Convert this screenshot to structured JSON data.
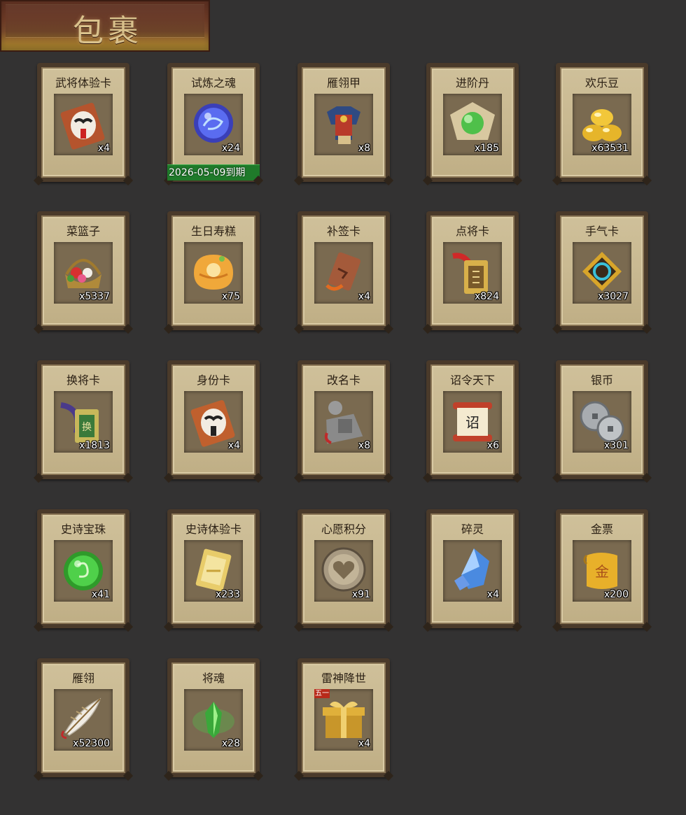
{
  "title": "包裹",
  "items": [
    {
      "name": "武将体验卡",
      "qty": "x4",
      "icon": "general-trial-card-icon"
    },
    {
      "name": "试炼之魂",
      "qty": "x24",
      "icon": "trial-soul-orb-icon",
      "expiry": "2026-05-09到期"
    },
    {
      "name": "雁翎甲",
      "qty": "x8",
      "icon": "armor-icon"
    },
    {
      "name": "进阶丹",
      "qty": "x185",
      "icon": "advance-pill-icon"
    },
    {
      "name": "欢乐豆",
      "qty": "x63531",
      "icon": "happy-beans-icon"
    },
    {
      "name": "菜篮子",
      "qty": "x5337",
      "icon": "flower-basket-icon"
    },
    {
      "name": "生日寿糕",
      "qty": "x75",
      "icon": "birthday-cake-icon"
    },
    {
      "name": "补签卡",
      "qty": "x4",
      "icon": "resign-card-icon"
    },
    {
      "name": "点将卡",
      "qty": "x824",
      "icon": "summon-general-card-icon"
    },
    {
      "name": "手气卡",
      "qty": "x3027",
      "icon": "luck-card-icon"
    },
    {
      "name": "换将卡",
      "qty": "x1813",
      "icon": "swap-general-card-icon"
    },
    {
      "name": "身份卡",
      "qty": "x4",
      "icon": "identity-card-icon"
    },
    {
      "name": "改名卡",
      "qty": "x8",
      "icon": "rename-card-icon"
    },
    {
      "name": "诏令天下",
      "qty": "x6",
      "icon": "imperial-edict-scroll-icon"
    },
    {
      "name": "银币",
      "qty": "x301",
      "icon": "silver-coins-icon"
    },
    {
      "name": "史诗宝珠",
      "qty": "x41",
      "icon": "epic-orb-icon"
    },
    {
      "name": "史诗体验卡",
      "qty": "x233",
      "icon": "epic-trial-card-icon"
    },
    {
      "name": "心愿积分",
      "qty": "x91",
      "icon": "wish-points-coin-icon"
    },
    {
      "name": "碎灵",
      "qty": "x4",
      "icon": "spirit-crystal-icon"
    },
    {
      "name": "金票",
      "qty": "x200",
      "icon": "gold-ticket-icon"
    },
    {
      "name": "雁翎",
      "qty": "x52300",
      "icon": "feather-icon"
    },
    {
      "name": "将魂",
      "qty": "x28",
      "icon": "general-soul-crystal-icon"
    },
    {
      "name": "雷神降世",
      "qty": "x4",
      "icon": "gift-box-icon",
      "badge": "五一"
    }
  ],
  "colors": {
    "background": "#333232",
    "card_face": "#cfc09a",
    "card_border": "#4a3a2a",
    "expiry_bar": "#1f7a2a"
  }
}
